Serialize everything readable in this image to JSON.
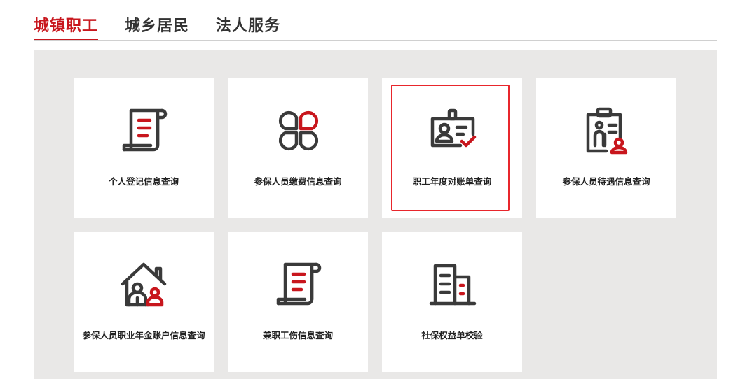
{
  "tabs": [
    {
      "label": "城镇职工",
      "active": true
    },
    {
      "label": "城乡居民",
      "active": false
    },
    {
      "label": "法人服务",
      "active": false
    }
  ],
  "colors": {
    "accent": "#c8161d",
    "icon_dark": "#3a3a3a",
    "panel_bg": "#e9e8e7"
  },
  "services": [
    {
      "label": "个人登记信息查询",
      "icon": "document-scroll-icon",
      "selected": false
    },
    {
      "label": "参保人员缴费信息查询",
      "icon": "clover-icon",
      "selected": false
    },
    {
      "label": "职工年度对账单查询",
      "icon": "id-card-check-icon",
      "selected": true
    },
    {
      "label": "参保人员待遇信息查询",
      "icon": "clipboard-elderly-icon",
      "selected": false
    },
    {
      "label": "参保人员职业年金账户信息查询",
      "icon": "house-people-icon",
      "selected": false
    },
    {
      "label": "兼职工伤信息查询",
      "icon": "document-scroll-icon",
      "selected": false
    },
    {
      "label": "社保权益单校验",
      "icon": "buildings-icon",
      "selected": false
    }
  ]
}
